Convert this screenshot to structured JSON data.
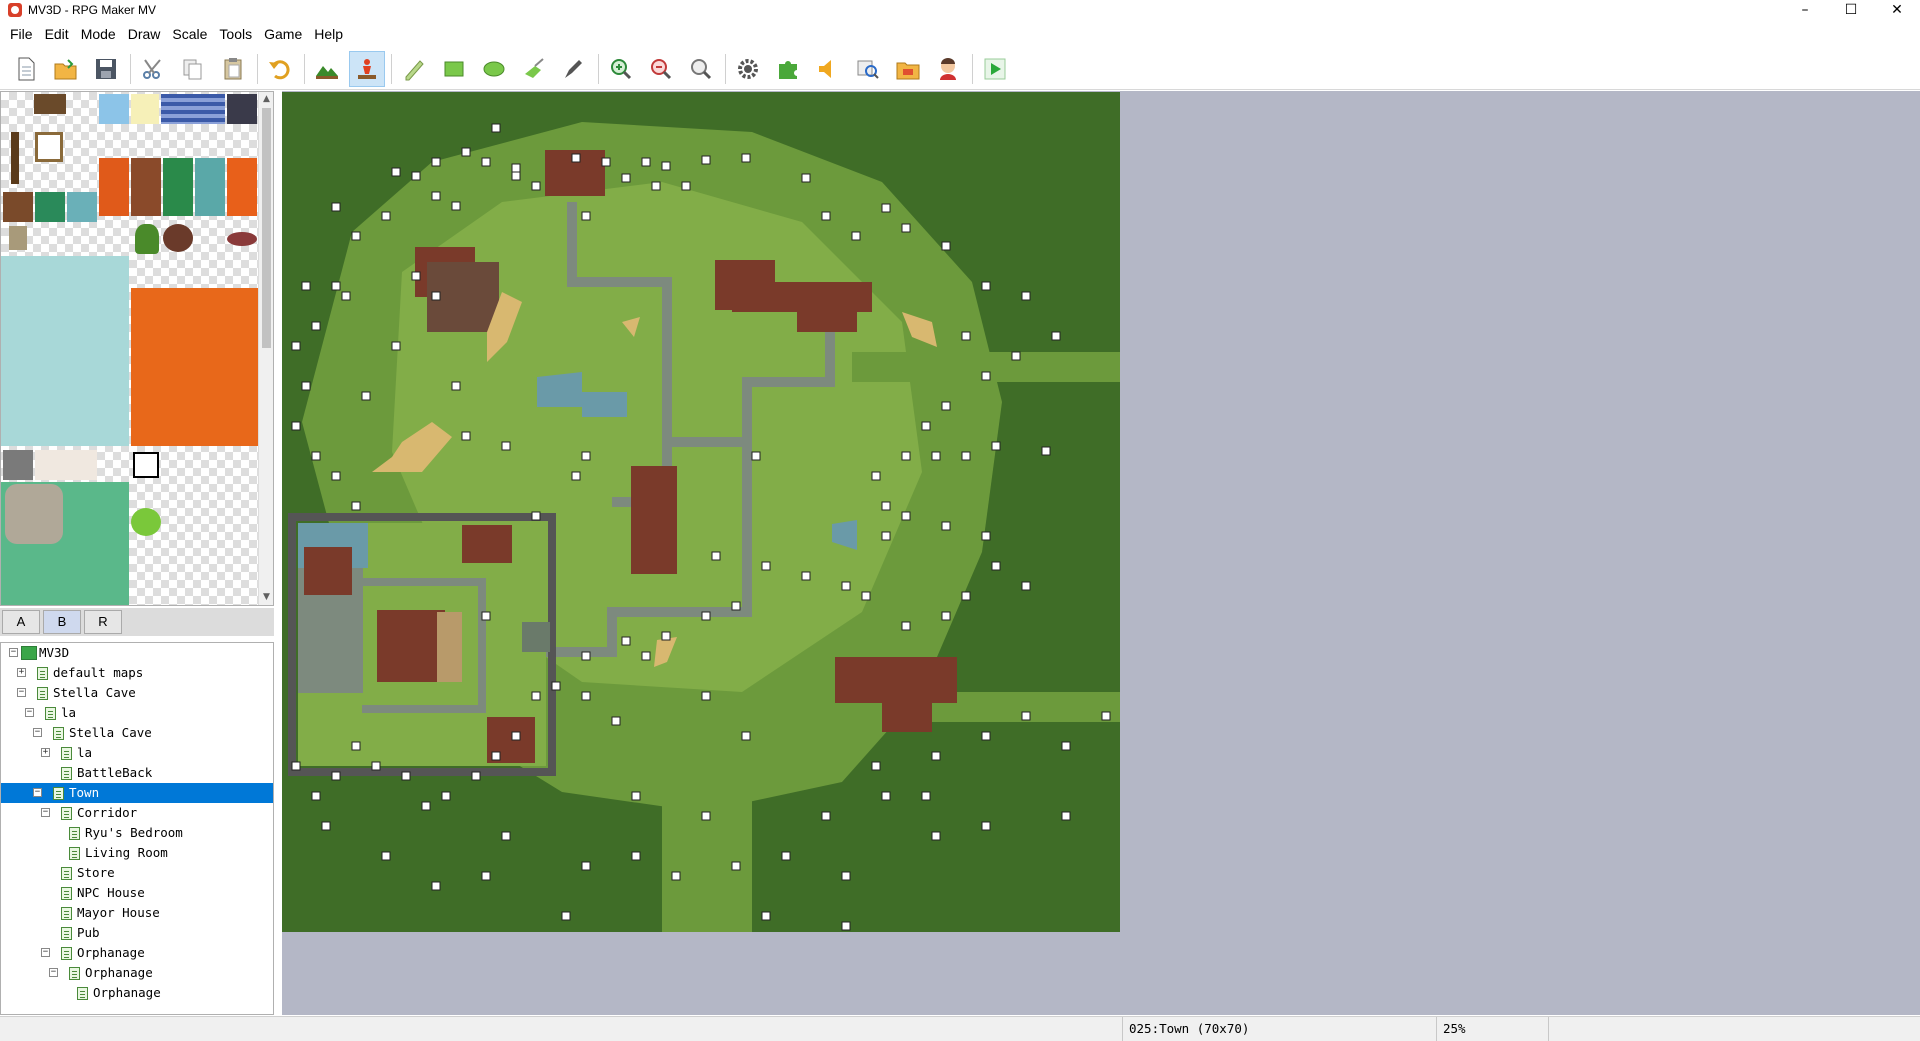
{
  "window": {
    "title": "MV3D - RPG Maker MV",
    "minimize": "–",
    "maximize": "☐",
    "close": "✕"
  },
  "menu": [
    "File",
    "Edit",
    "Mode",
    "Draw",
    "Scale",
    "Tools",
    "Game",
    "Help"
  ],
  "toolbar": {
    "groups": [
      [
        "new-project",
        "open-project",
        "save-project"
      ],
      [
        "cut",
        "copy",
        "paste"
      ],
      [
        "undo"
      ],
      [
        "map-mode",
        "event-mode"
      ],
      [
        "pencil",
        "rectangle",
        "ellipse",
        "flood-fill",
        "shadow-pen"
      ],
      [
        "zoom-in",
        "zoom-out",
        "actual-size"
      ],
      [
        "database",
        "plugin-manager",
        "sound-test",
        "event-searcher",
        "resource-manager",
        "character-generator"
      ],
      [
        "playtest"
      ]
    ],
    "active_tool": "event-mode"
  },
  "tileset_tabs": [
    "A",
    "B",
    "R"
  ],
  "active_tab": "B",
  "map_tree": [
    {
      "label": "MV3D",
      "depth": 0,
      "expander": "minus",
      "icon": "root"
    },
    {
      "label": "default maps",
      "depth": 1,
      "expander": "plus"
    },
    {
      "label": "Stella Cave",
      "depth": 1,
      "expander": "minus"
    },
    {
      "label": "la",
      "depth": 2,
      "expander": "minus"
    },
    {
      "label": "Stella Cave",
      "depth": 3,
      "expander": "minus"
    },
    {
      "label": "la",
      "depth": 4,
      "expander": "plus"
    },
    {
      "label": "BattleBack",
      "depth": 4,
      "expander": "none"
    },
    {
      "label": "Town",
      "depth": 3,
      "expander": "minus",
      "selected": true
    },
    {
      "label": "Corridor",
      "depth": 4,
      "expander": "minus"
    },
    {
      "label": "Ryu's Bedroom",
      "depth": 5,
      "expander": "none"
    },
    {
      "label": "Living Room",
      "depth": 5,
      "expander": "none"
    },
    {
      "label": "Store",
      "depth": 4,
      "expander": "none"
    },
    {
      "label": "NPC House",
      "depth": 4,
      "expander": "none"
    },
    {
      "label": "Mayor House",
      "depth": 4,
      "expander": "none"
    },
    {
      "label": "Pub",
      "depth": 4,
      "expander": "none"
    },
    {
      "label": "Orphanage",
      "depth": 4,
      "expander": "minus"
    },
    {
      "label": "Orphanage",
      "depth": 5,
      "expander": "minus"
    },
    {
      "label": "Orphanage",
      "depth": 6,
      "expander": "none"
    }
  ],
  "status": {
    "blank": "",
    "map_info": "025:Town (70x70)",
    "zoom": "25%"
  },
  "colors": {
    "workspace_bg": "#b4b7c6",
    "selection": "#0078d7",
    "grass": "#6c9a3c",
    "dark_grass": "#3f6d27",
    "road": "#7d8a7e",
    "roof": "#7a3a2a"
  }
}
